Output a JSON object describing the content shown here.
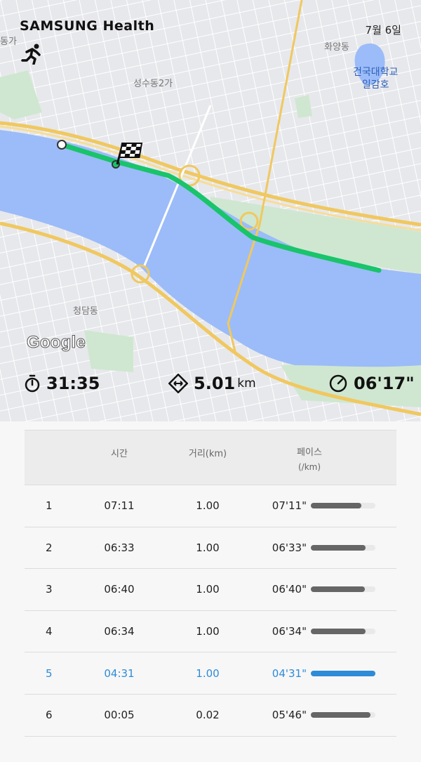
{
  "header": {
    "brand": "SAMSUNG Health",
    "date": "7월 6일"
  },
  "map": {
    "provider": "Google",
    "labels": {
      "lake": "건국대학교\n일감호",
      "district1": "화양동",
      "district2": "청담동",
      "district3": "성수동2가",
      "district4": "동가"
    },
    "colors": {
      "route": "#19c46b",
      "water": "#9bbcf8",
      "park": "#cfe7d0",
      "land": "#e7e8ec",
      "highway": "#f0c860"
    }
  },
  "summary": {
    "duration": "31:35",
    "distance": "5.01",
    "distance_unit": "km",
    "pace": "06'17\""
  },
  "table": {
    "headers": {
      "time": "시간",
      "distance": "거리(km)",
      "pace": "페이스",
      "pace_unit": "(/km)"
    },
    "rows": [
      {
        "idx": "1",
        "time": "07:11",
        "distance": "1.00",
        "pace": "07'11\"",
        "bar": 0.78,
        "highlight": false
      },
      {
        "idx": "2",
        "time": "06:33",
        "distance": "1.00",
        "pace": "06'33\"",
        "bar": 0.85,
        "highlight": false
      },
      {
        "idx": "3",
        "time": "06:40",
        "distance": "1.00",
        "pace": "06'40\"",
        "bar": 0.84,
        "highlight": false
      },
      {
        "idx": "4",
        "time": "06:34",
        "distance": "1.00",
        "pace": "06'34\"",
        "bar": 0.85,
        "highlight": false
      },
      {
        "idx": "5",
        "time": "04:31",
        "distance": "1.00",
        "pace": "04'31\"",
        "bar": 1.0,
        "highlight": true
      },
      {
        "idx": "6",
        "time": "00:05",
        "distance": "0.02",
        "pace": "05'46\"",
        "bar": 0.92,
        "highlight": false
      }
    ]
  }
}
